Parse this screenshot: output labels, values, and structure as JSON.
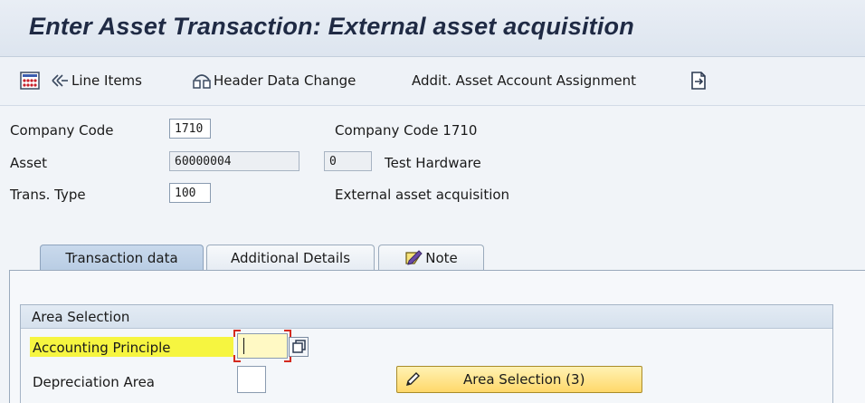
{
  "title": "Enter Asset Transaction: External asset acquisition",
  "toolbar": {
    "line_items": "Line Items",
    "header_data_change": "Header Data Change",
    "addit_account": "Addit. Asset Account Assignment"
  },
  "header": {
    "company_code_label": "Company Code",
    "company_code_value": "1710",
    "company_code_desc": "Company Code 1710",
    "asset_label": "Asset",
    "asset_value": "60000004",
    "asset_sub": "0",
    "asset_desc": "Test Hardware",
    "trans_type_label": "Trans. Type",
    "trans_type_value": "100",
    "trans_type_desc": "External asset acquisition"
  },
  "tabs": [
    {
      "label": "Transaction data"
    },
    {
      "label": "Additional Details"
    },
    {
      "label": "Note"
    }
  ],
  "area_selection": {
    "group_title": "Area Selection",
    "accounting_principle_label": "Accounting Principle",
    "accounting_principle_value": "",
    "depreciation_area_label": "Depreciation Area",
    "depreciation_area_value": "",
    "button_label": "Area Selection (3)"
  },
  "colors": {
    "highlight": "#f6f540",
    "button": "#ffd86a",
    "focus_marker": "#d42a1f"
  }
}
